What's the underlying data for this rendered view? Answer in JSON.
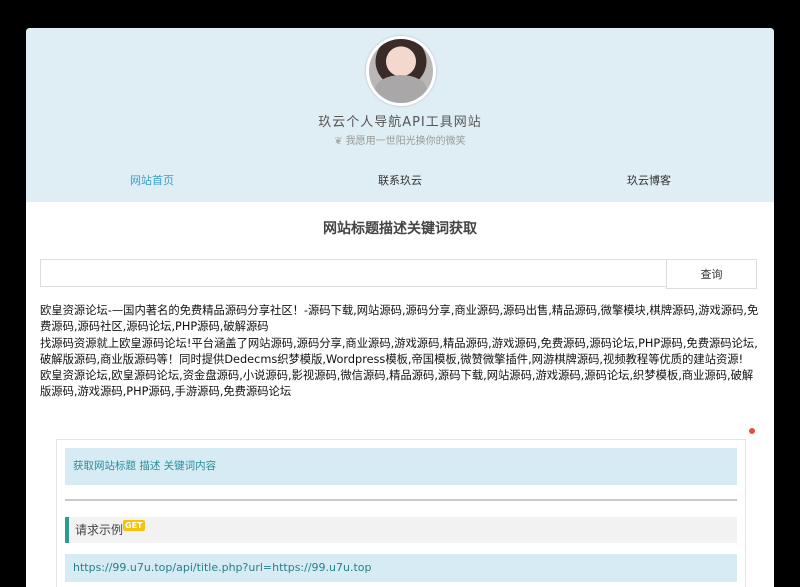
{
  "header": {
    "site_title": "玖云个人导航API工具网站",
    "motto": "我愿用一世阳光换你的微笑",
    "nav": [
      {
        "label": "网站首页",
        "active": true
      },
      {
        "label": "联系玖云",
        "active": false
      },
      {
        "label": "玖云博客",
        "active": false
      }
    ]
  },
  "main": {
    "heading": "网站标题描述关键词获取",
    "search": {
      "value": "",
      "placeholder": "",
      "button_label": "查询"
    },
    "result": {
      "title": "欧皇资源论坛-—国内著名的免费精品源码分享社区！-源码下载,网站源码,源码分享,商业源码,源码出售,精品源码,微擎模块,棋牌源码,游戏源码,免费源码,源码社区,源码论坛,PHP源码,破解源码",
      "description": "找源码资源就上欧皇源码论坛!平台涵盖了网站源码,源码分享,商业源码,游戏源码,精品源码,游戏源码,免费源码,源码论坛,PHP源码,免费源码论坛,破解版源码,商业版源码等！同时提供Dedecms织梦模版,Wordpress模板,帝国模板,微赞微擎插件,网游棋牌源码,视频教程等优质的建站资源!",
      "keywords": "欧皇资源论坛,欧皇源码论坛,资金盘源码,小说源码,影视源码,微信源码,精品源码,源码下载,网站源码,游戏源码,源码论坛,织梦模板,商业源码,破解版源码,游戏源码,PHP源码,手游源码,免费源码论坛"
    }
  },
  "doc": {
    "banner": "获取网站标题 描述 关键词内容",
    "request_heading": "请求示例",
    "method_badge": "GET",
    "request_url": "https://99.u7u.top/api/title.php?url=https://99.u7u.top"
  },
  "colors": {
    "hero_bg": "#dfeef4",
    "accent": "#3aa0c8",
    "doc_accent": "#2a9d8f",
    "badge": "#f1c40f",
    "dot": "#e74c3c"
  }
}
